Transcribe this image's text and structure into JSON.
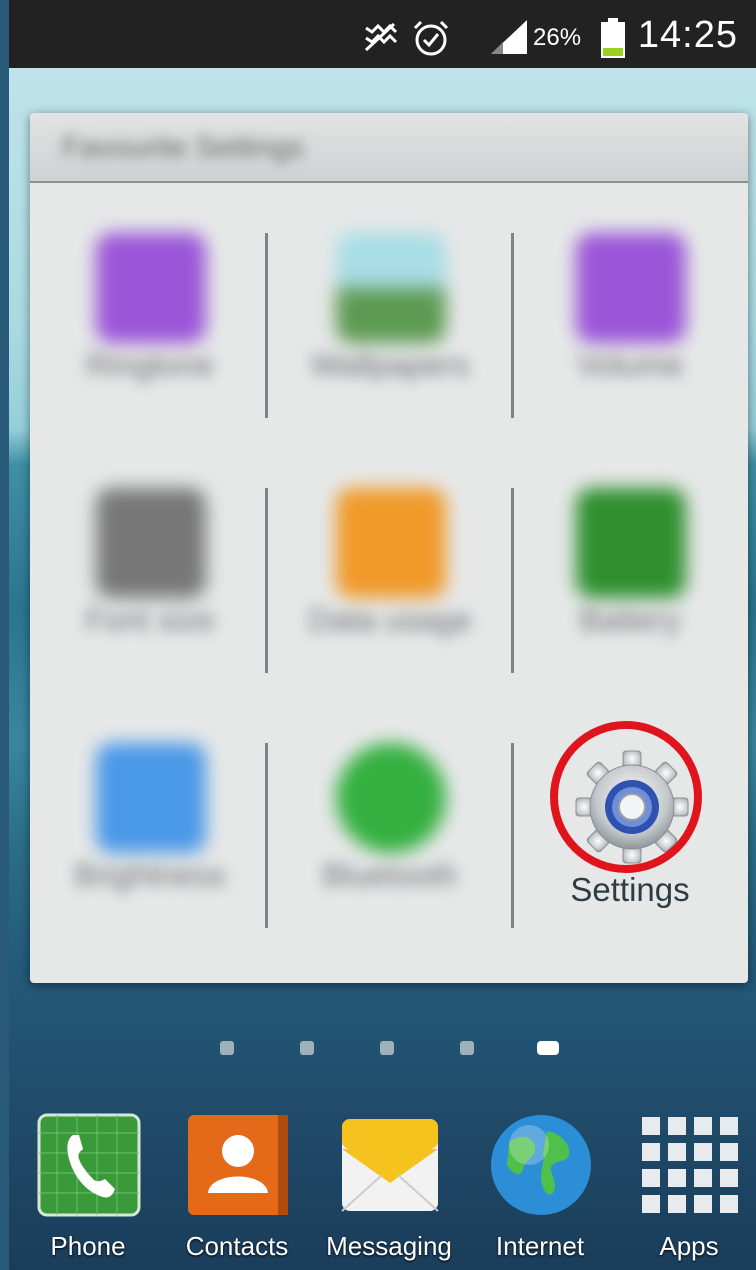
{
  "status_bar": {
    "icons": [
      "mute-icon",
      "alarm-icon",
      "signal-icon",
      "battery-icon"
    ],
    "battery_percent": "26%",
    "time": "14:25"
  },
  "folder": {
    "title": "Favourite Settings",
    "apps": [
      {
        "label": "Ringtone",
        "icon": "ringtone-icon",
        "color": "#9a55d8"
      },
      {
        "label": "Wallpapers",
        "icon": "wallpaper-icon",
        "color": "#6ea060"
      },
      {
        "label": "Volume",
        "icon": "volume-icon",
        "color": "#9a55d8"
      },
      {
        "label": "Font size",
        "icon": "font-size-icon",
        "color": "#777777"
      },
      {
        "label": "Data usage",
        "icon": "data-usage-icon",
        "color": "#f09a2a"
      },
      {
        "label": "Battery",
        "icon": "battery-app-icon",
        "color": "#2f8f2f"
      },
      {
        "label": "Brightness",
        "icon": "brightness-icon",
        "color": "#4a98e8"
      },
      {
        "label": "Bluetooth",
        "icon": "bluetooth-icon",
        "color": "#34b040"
      },
      {
        "label": "Settings",
        "icon": "gear-icon",
        "color": "#3c5fb0"
      }
    ]
  },
  "page_indicator": {
    "count": 5,
    "active": 5
  },
  "dock": [
    {
      "label": "Phone",
      "icon": "phone-icon",
      "color": "#3a9a3a"
    },
    {
      "label": "Contacts",
      "icon": "contacts-icon",
      "color": "#e46a1a"
    },
    {
      "label": "Messaging",
      "icon": "messaging-icon",
      "color": "#f6c21e"
    },
    {
      "label": "Internet",
      "icon": "globe-icon",
      "color": "#2b8ed6"
    },
    {
      "label": "Apps",
      "icon": "apps-grid-icon",
      "color": "#e8ebee"
    }
  ]
}
